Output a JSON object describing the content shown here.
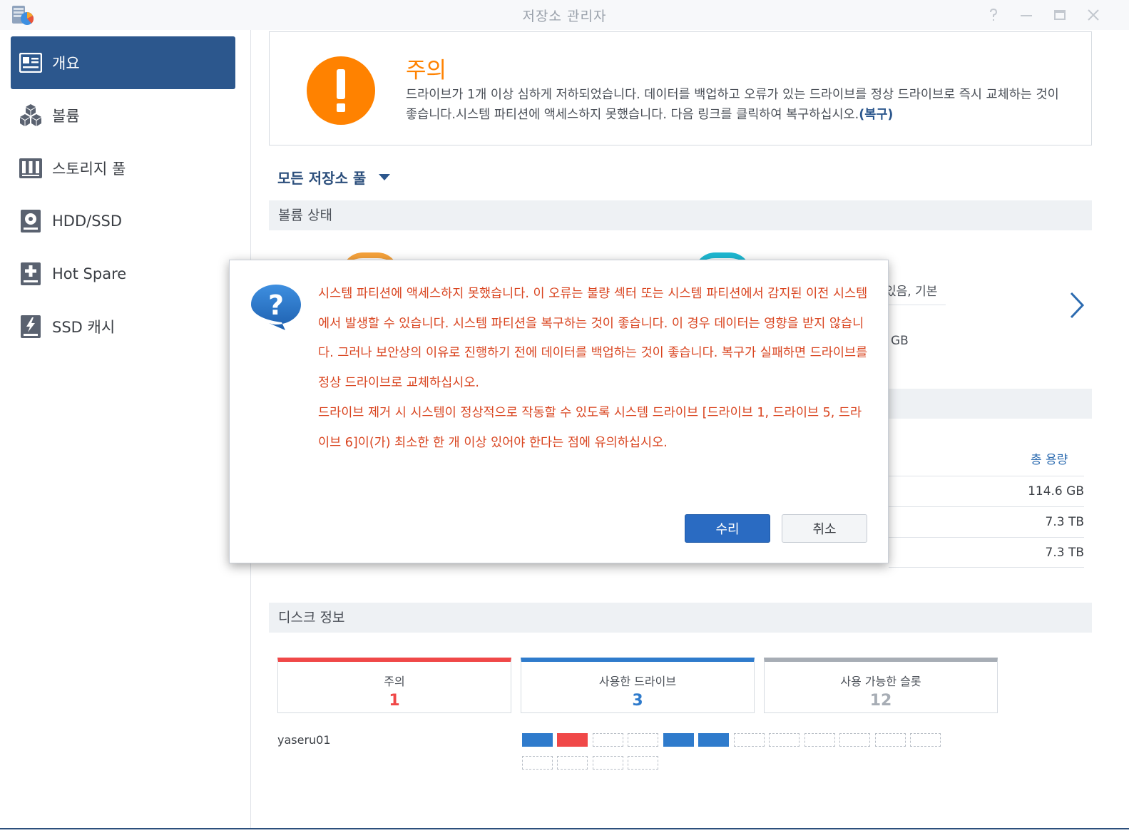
{
  "window": {
    "title": "저장소 관리자",
    "controls": [
      "help-icon",
      "minimize-icon",
      "maximize-icon",
      "close-icon"
    ]
  },
  "sidebar": {
    "items": [
      {
        "label": "개요",
        "icon": "overview-icon",
        "active": true
      },
      {
        "label": "볼륨",
        "icon": "volume-cubes-icon",
        "active": false
      },
      {
        "label": "스토리지 풀",
        "icon": "storage-pool-icon",
        "active": false
      },
      {
        "label": "HDD/SSD",
        "icon": "hdd-icon",
        "active": false
      },
      {
        "label": "Hot Spare",
        "icon": "hot-spare-icon",
        "active": false
      },
      {
        "label": "SSD 캐시",
        "icon": "ssd-cache-icon",
        "active": false
      }
    ]
  },
  "alert": {
    "title": "주의",
    "message": "드라이브가 1개 이상 심하게 저하되었습니다. 데이터를 백업하고 오류가 있는 드라이브를 정상 드라이브로 즉시 교체하는 것이 좋습니다.시스템 파티션에 액세스하지 못했습니다. 다음 링크를 클릭하여 복구하십시오.",
    "link": "(복구)"
  },
  "pool_selector": {
    "label": "모든 저장소 풀"
  },
  "volume_status": {
    "header": "볼륨 상태",
    "partial_text_1": "있음, 기본",
    "partial_text_2": "GB"
  },
  "capacity_table": {
    "header": "총 용량",
    "values": [
      "114.6 GB",
      "7.3 TB",
      "7.3 TB"
    ]
  },
  "disk_info": {
    "header": "디스크 정보",
    "cards": [
      {
        "label": "주의",
        "value": "1",
        "color": "#f04848"
      },
      {
        "label": "사용한 드라이브",
        "value": "3",
        "color": "#2f7bcc"
      },
      {
        "label": "사용 가능한 슬롯",
        "value": "12",
        "color": "#a7adb5"
      }
    ],
    "host": "yaseru01",
    "slots_row1": [
      "used",
      "warning",
      "empty",
      "empty",
      "used",
      "used",
      "empty",
      "empty",
      "empty",
      "empty",
      "empty",
      "empty"
    ],
    "slots_row2": [
      "empty",
      "empty",
      "empty",
      "empty"
    ]
  },
  "dialog": {
    "icon": "question-icon",
    "paragraph1": "시스템 파티션에 액세스하지 못했습니다. 이 오류는 불량 섹터 또는 시스템 파티션에서 감지된 이전 시스템에서 발생할 수 있습니다. 시스템 파티션을 복구하는 것이 좋습니다. 이 경우 데이터는 영향을 받지 않습니다. 그러나 보안상의 이유로 진행하기 전에 데이터를 백업하는 것이 좋습니다. 복구가 실패하면 드라이브를 정상 드라이브로 교체하십시오.",
    "paragraph2": "드라이브 제거 시 시스템이 정상적으로 작동할 수 있도록 시스템 드라이브 [드라이브 1, 드라이브 5, 드라이브 6]이(가) 최소한 한 개 이상 있어야 한다는 점에 유의하십시오.",
    "confirm_label": "수리",
    "cancel_label": "취소"
  }
}
